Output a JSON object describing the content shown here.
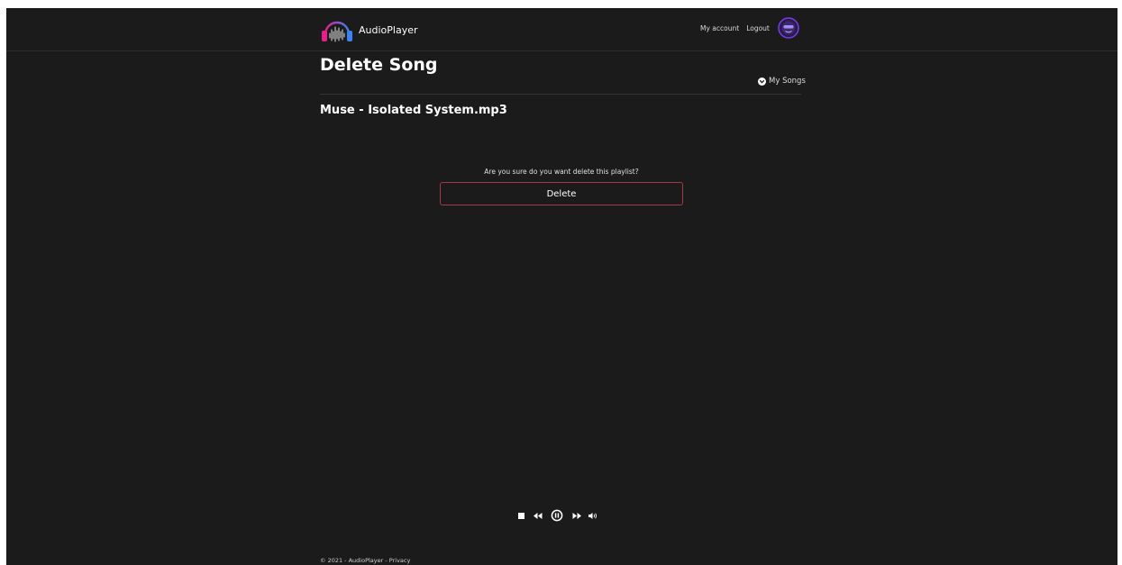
{
  "app": {
    "name": "AudioPlayer",
    "logo_icon": "headphones-waveform-icon"
  },
  "nav": {
    "my_account": "My account",
    "logout": "Logout",
    "avatar_icon": "user-avatar-icon"
  },
  "page": {
    "title": "Delete Song",
    "back_link": "My Songs",
    "back_link_icon": "circle-chevron-down-icon"
  },
  "song": {
    "name": "Muse - Isolated System.mp3"
  },
  "confirm": {
    "question": "Are you sure do you want delete this playlist?",
    "button_label": "Delete"
  },
  "player": {
    "controls": [
      "stop-icon",
      "rewind-icon",
      "pause-icon",
      "fast-forward-icon",
      "volume-icon"
    ]
  },
  "footer": {
    "copyright": "© 2021 - ",
    "brand": "AudioPlayer",
    "separator": " - ",
    "privacy": "Privacy"
  },
  "colors": {
    "background": "#1b1b1b",
    "delete_border": "#a13a45",
    "logo_gradient": [
      "#e91e8c",
      "#3b82f6"
    ],
    "avatar_accent": "#7c3aed"
  }
}
